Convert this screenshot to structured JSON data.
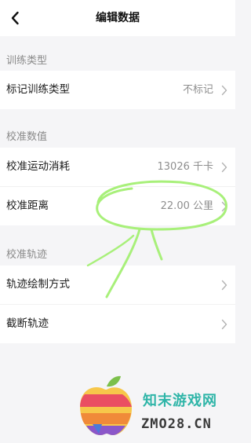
{
  "header": {
    "title": "编辑数据",
    "back_icon": "back-arrow-icon"
  },
  "sections": {
    "training_type": {
      "label": "训练类型",
      "rows": [
        {
          "label": "标记训练类型",
          "value": "不标记"
        }
      ]
    },
    "calibration": {
      "label": "校准数值",
      "rows": [
        {
          "label": "校准运动消耗",
          "value": "13026 千卡"
        },
        {
          "label": "校准距离",
          "value": "22.00 公里"
        }
      ]
    },
    "track": {
      "label": "校准轨迹",
      "rows": [
        {
          "label": "轨迹绘制方式",
          "value": ""
        },
        {
          "label": "截断轨迹",
          "value": ""
        }
      ]
    }
  },
  "watermark": {
    "name": "知末游戏网",
    "domain": "ZMO28.CN"
  },
  "colors": {
    "background": "#f5f5f7",
    "card": "#ffffff",
    "annotation": "#a8f07a",
    "watermark_green": "#2fb5a8"
  }
}
